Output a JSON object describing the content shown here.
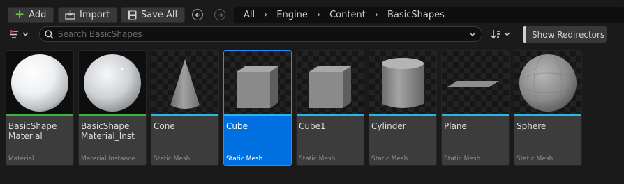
{
  "toolbar": {
    "add_label": "Add",
    "import_label": "Import",
    "save_all_label": "Save All"
  },
  "breadcrumbs": [
    "All",
    "Engine",
    "Content",
    "BasicShapes"
  ],
  "search": {
    "placeholder": "Search BasicShapes"
  },
  "redirectors": {
    "label": "Show Redirectors"
  },
  "assets": [
    {
      "name": "BasicShape Material",
      "type": "Material",
      "thumb": "sphere-white",
      "strip": "green",
      "selected": false
    },
    {
      "name": "BasicShape Material_Inst",
      "type": "Material Instance",
      "thumb": "sphere-white-glossy",
      "strip": "green",
      "selected": false
    },
    {
      "name": "Cone",
      "type": "Static Mesh",
      "thumb": "cone",
      "strip": "cyan",
      "selected": false
    },
    {
      "name": "Cube",
      "type": "Static Mesh",
      "thumb": "cube",
      "strip": "cyan",
      "selected": true
    },
    {
      "name": "Cube1",
      "type": "Static Mesh",
      "thumb": "cube",
      "strip": "cyan",
      "selected": false
    },
    {
      "name": "Cylinder",
      "type": "Static Mesh",
      "thumb": "cylinder",
      "strip": "cyan",
      "selected": false
    },
    {
      "name": "Plane",
      "type": "Static Mesh",
      "thumb": "plane",
      "strip": "cyan",
      "selected": false
    },
    {
      "name": "Sphere",
      "type": "Static Mesh",
      "thumb": "sphere-checker",
      "strip": "cyan",
      "selected": false
    }
  ],
  "colors": {
    "background": "#1a1a1a",
    "tile": "#3c3c3c",
    "selected": "#0070e0",
    "material_strip": "#3bb13b",
    "mesh_strip": "#29b6e6",
    "add_icon": "#6ec64a",
    "filter_icon_dot": "#e03030"
  },
  "icons": {
    "add": "plus-icon",
    "import": "import-icon",
    "save": "floppy-disk-icon",
    "back": "arrow-left-circle-icon",
    "forward": "arrow-right-circle-icon",
    "filter": "filter-icon",
    "search": "search-icon",
    "sort": "sort-icon"
  }
}
